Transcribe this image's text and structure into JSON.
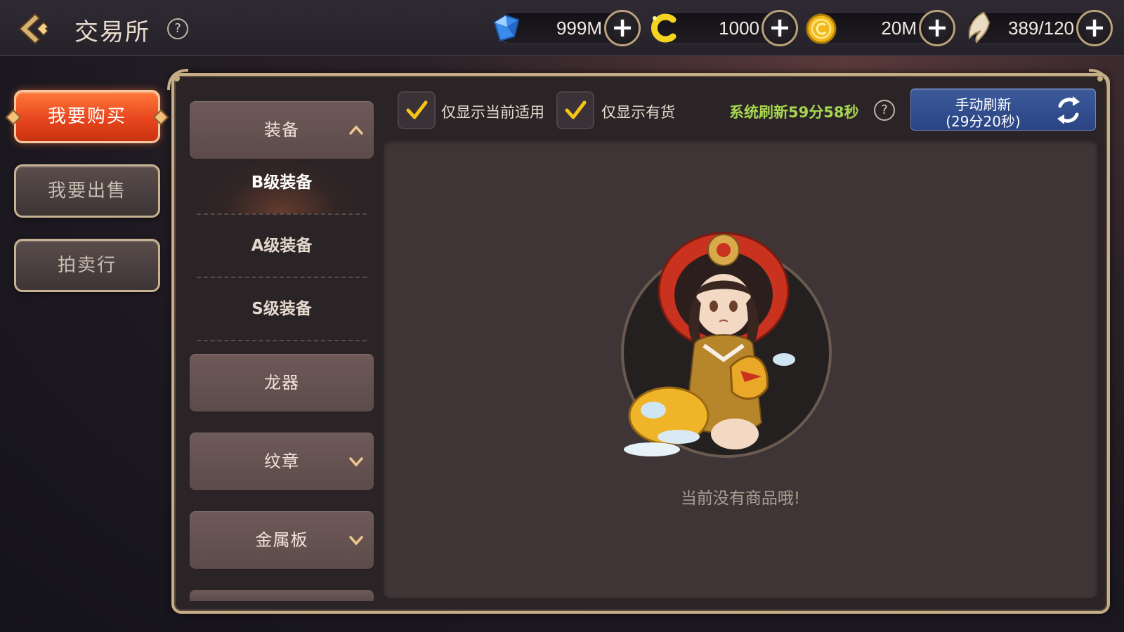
{
  "header": {
    "title": "交易所",
    "help_symbol": "?",
    "currencies": [
      {
        "icon": "diamond-gem-icon",
        "value": "999M",
        "add_symbol": "+"
      },
      {
        "icon": "gold-c-coin-icon",
        "value": "1000",
        "add_symbol": "+"
      },
      {
        "icon": "gold-coin-icon",
        "value": "20M",
        "add_symbol": "+"
      },
      {
        "icon": "stamina-wing-icon",
        "value": "389/120",
        "add_symbol": "+"
      }
    ]
  },
  "nav": {
    "buy": "我要购买",
    "sell": "我要出售",
    "auction": "拍卖行"
  },
  "categories": {
    "equipment": "装备",
    "sub_items": [
      "B级装备",
      "A级装备",
      "S级装备"
    ],
    "selected_sub": "B级装备",
    "dragon": "龙器",
    "emblem": "纹章",
    "metal_plate": "金属板"
  },
  "filters": {
    "current_only": "仅显示当前适用",
    "in_stock_only": "仅显示有货",
    "current_only_checked": true,
    "in_stock_only_checked": true,
    "system_refresh": "系统刷新59分58秒",
    "help_symbol": "?"
  },
  "manual_refresh": {
    "line1": "手动刷新",
    "line2": "(29分20秒)"
  },
  "empty_state": {
    "message": "当前没有商品哦!"
  },
  "colors": {
    "active_nav": "#e8461e",
    "frame_gold": "#c5ad86",
    "refresh_green": "#a7d650",
    "manual_refresh_blue": "#2a4484"
  }
}
